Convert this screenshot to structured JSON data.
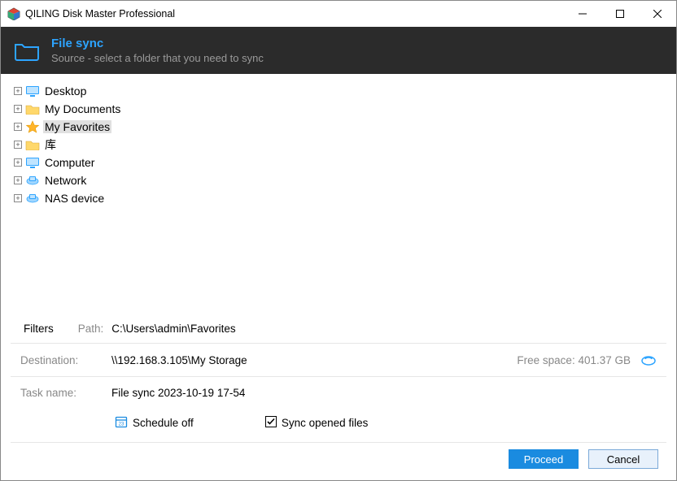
{
  "window": {
    "title": "QILING Disk Master Professional"
  },
  "header": {
    "title": "File sync",
    "subtitle": "Source - select a folder that you need to sync"
  },
  "tree": {
    "items": [
      {
        "label": "Desktop",
        "icon": "monitor"
      },
      {
        "label": "My Documents",
        "icon": "folder"
      },
      {
        "label": "My Favorites",
        "icon": "star",
        "selected": true
      },
      {
        "label": "库",
        "icon": "folder"
      },
      {
        "label": "Computer",
        "icon": "monitor"
      },
      {
        "label": "Network",
        "icon": "network"
      },
      {
        "label": "NAS device",
        "icon": "network"
      }
    ]
  },
  "filters": {
    "label": "Filters",
    "path_label": "Path:",
    "path": "C:\\Users\\admin\\Favorites"
  },
  "destination": {
    "label": "Destination:",
    "value": "\\\\192.168.3.105\\My Storage",
    "free_label": "Free space: 401.37 GB"
  },
  "task": {
    "label": "Task name:",
    "value": "File sync 2023-10-19 17-54"
  },
  "options": {
    "schedule": "Schedule off",
    "sync_opened": "Sync opened files",
    "sync_checked": true
  },
  "buttons": {
    "proceed": "Proceed",
    "cancel": "Cancel"
  }
}
